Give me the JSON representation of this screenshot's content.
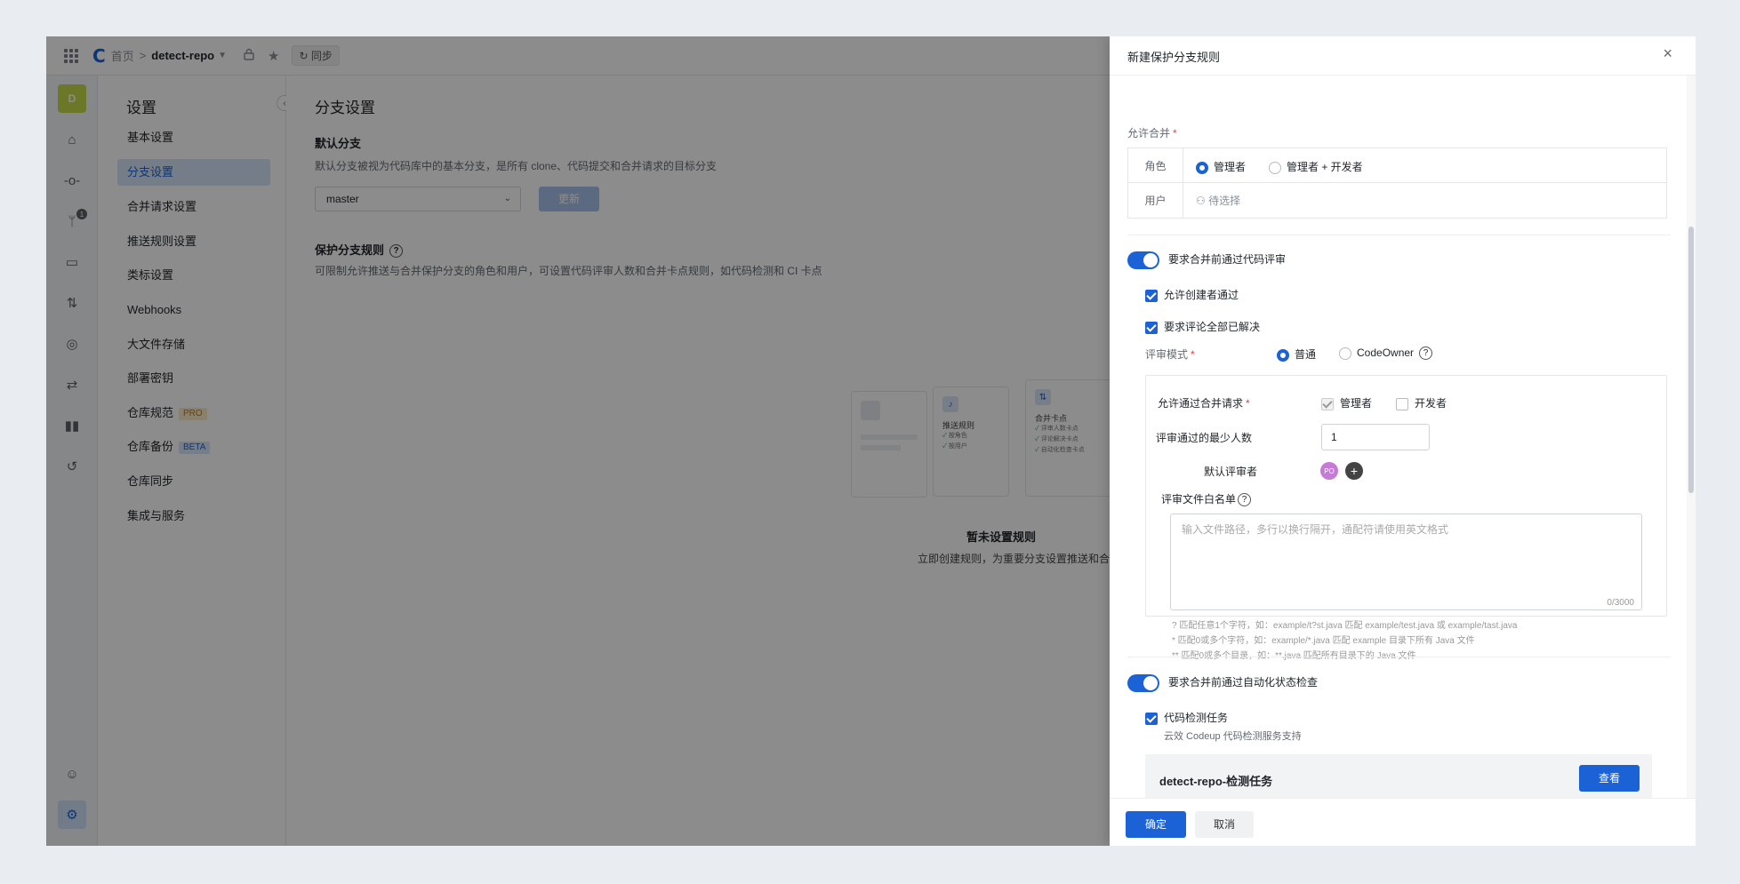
{
  "topbar": {
    "home": "首页",
    "separator": ">",
    "repo": "detect-repo",
    "sync": "同步",
    "logo": "C"
  },
  "rail": {
    "avatar": "D",
    "badge": "1"
  },
  "menu": {
    "title": "设置",
    "items": [
      {
        "label": "基本设置"
      },
      {
        "label": "分支设置"
      },
      {
        "label": "合并请求设置"
      },
      {
        "label": "推送规则设置"
      },
      {
        "label": "类标设置"
      },
      {
        "label": "Webhooks"
      },
      {
        "label": "大文件存储"
      },
      {
        "label": "部署密钥"
      },
      {
        "label": "仓库规范",
        "tag": "PRO"
      },
      {
        "label": "仓库备份",
        "tag": "BETA"
      },
      {
        "label": "仓库同步"
      },
      {
        "label": "集成与服务"
      }
    ]
  },
  "main": {
    "title": "分支设置",
    "default_branch": {
      "heading": "默认分支",
      "desc": "默认分支被视为代码库中的基本分支，是所有 clone、代码提交和合并请求的目标分支",
      "value": "master",
      "button": "更新"
    },
    "protected": {
      "heading": "保护分支规则",
      "help": "?",
      "desc": "可限制允许推送与合并保护分支的角色和用户，可设置代码评审人数和合并卡点规则，如代码检测和 CI 卡点"
    },
    "illustration": {
      "push": {
        "title": "推送规则",
        "items": [
          "按角色",
          "按用户"
        ]
      },
      "merge": {
        "title": "合并卡点",
        "items": [
          "评审人数卡点",
          "评论解决卡点",
          "自动化检查卡点"
        ]
      }
    },
    "empty": {
      "title": "暂未设置规则",
      "desc": "立即创建规则，为重要分支设置推送和合并卡点保"
    }
  },
  "drawer": {
    "title": "新建保护分支规则",
    "close": "×",
    "allow_merge": {
      "label": "允许合并",
      "required": "*",
      "role_label": "角色",
      "role_options": [
        "管理者",
        "管理者 + 开发者"
      ],
      "user_label": "用户",
      "user_placeholder": "待选择"
    },
    "code_review": {
      "switch_label": "要求合并前通过代码评审",
      "allow_creator": "允许创建者通过",
      "require_resolved": "要求评论全部已解决",
      "mode_label": "评审模式",
      "required": "*",
      "mode_options": [
        "普通",
        "CodeOwner"
      ],
      "help": "?",
      "allow_pass_label": "允许通过合并请求",
      "allow_pass_options": [
        "管理者",
        "开发者"
      ],
      "min_reviewers_label": "评审通过的最少人数",
      "min_reviewers": "1",
      "default_reviewer_label": "默认评审者",
      "reviewer_avatar": "PO",
      "add": "+",
      "whitelist_label": "评审文件白名单",
      "whitelist_placeholder": "输入文件路径，多行以换行隔开，通配符请使用英文格式",
      "counter": "0/3000",
      "hints": [
        "? 匹配任意1个字符，如：example/t?st.java 匹配 example/test.java 或 example/tast.java",
        "* 匹配0或多个字符，如：example/*.java 匹配 example 目录下所有 Java 文件",
        "** 匹配0或多个目录，如：**.java 匹配所有目录下的 Java 文件"
      ]
    },
    "auto_check": {
      "switch_label": "要求合并前通过自动化状态检查",
      "task_label": "代码检测任务",
      "task_sub": "云效 Codeup 代码检测服务支持",
      "task_name": "detect-repo-检测任务",
      "view": "查看"
    },
    "footer": {
      "confirm": "确定",
      "cancel": "取消"
    }
  },
  "colors": {
    "primary": "#1b62d6",
    "overlay": "rgba(0,0,0,0.45)",
    "required": "#e04545"
  }
}
